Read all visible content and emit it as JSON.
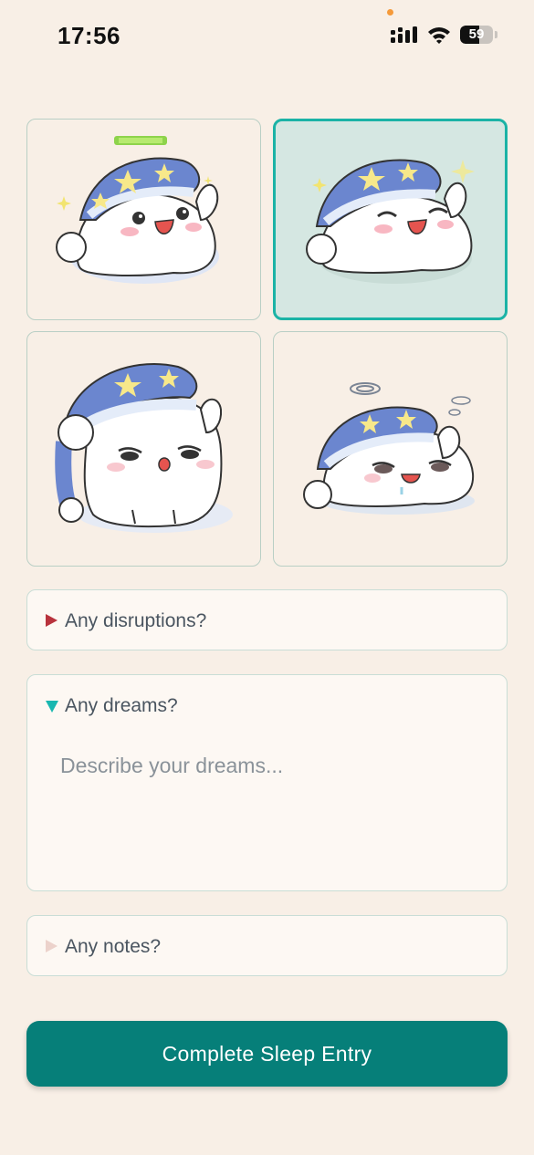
{
  "status_bar": {
    "time": "17:56",
    "battery_level": "59",
    "battery_fraction": 0.59
  },
  "mood_options": [
    {
      "icon": "happy-sleepy-cat-icon",
      "selected": false
    },
    {
      "icon": "blissful-sleepy-cat-icon",
      "selected": true
    },
    {
      "icon": "tired-sleepy-cat-icon",
      "selected": false
    },
    {
      "icon": "exhausted-sleepy-cat-icon",
      "selected": false
    }
  ],
  "sections": {
    "disruptions": {
      "label": "Any disruptions?",
      "expanded": false
    },
    "dreams": {
      "label": "Any dreams?",
      "expanded": true,
      "value": "",
      "placeholder": "Describe your dreams..."
    },
    "notes": {
      "label": "Any notes?",
      "expanded": false
    }
  },
  "actions": {
    "complete_label": "Complete Sleep Entry"
  },
  "colors": {
    "background": "#f8efe6",
    "accent": "#067f79",
    "selected_border": "#1bb3a6",
    "selected_fill": "#d5e7e2",
    "disruption_marker": "#b8323c",
    "dreams_marker": "#19b7b0"
  }
}
